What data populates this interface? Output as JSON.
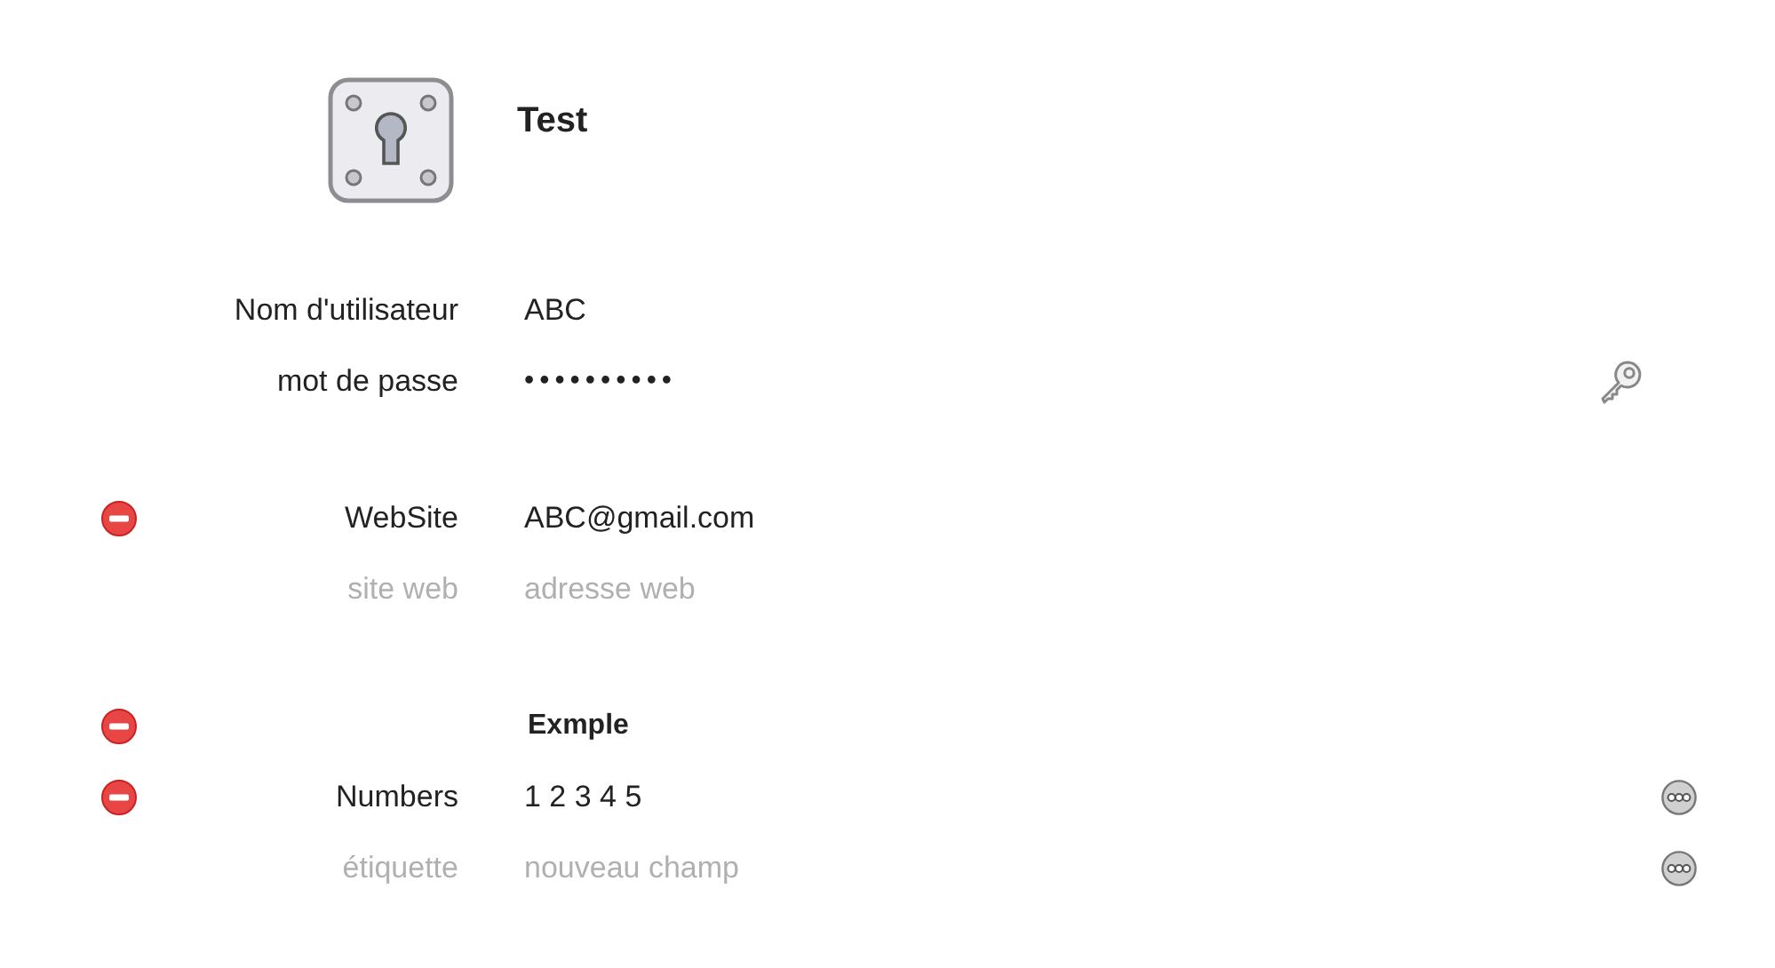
{
  "title": "Test",
  "groups": [
    {
      "rows": [
        {
          "kind": "field",
          "label": "Nom d'utilisateur",
          "value": "ABC",
          "removable": false,
          "key_button": false,
          "options_button": false
        },
        {
          "kind": "secret",
          "label": "mot de passe",
          "value": "••••••••••",
          "removable": false,
          "key_button": true,
          "options_button": false
        }
      ]
    },
    {
      "rows": [
        {
          "kind": "field",
          "label": "WebSite",
          "value": "ABC@gmail.com",
          "removable": true,
          "key_button": false,
          "options_button": false
        },
        {
          "kind": "new_field",
          "label_placeholder": "site web",
          "placeholder": "adresse web",
          "removable": false,
          "key_button": false,
          "options_button": false
        }
      ]
    },
    {
      "rows": [
        {
          "kind": "section",
          "title": "Exmple",
          "removable": true,
          "key_button": false,
          "options_button": false
        },
        {
          "kind": "field",
          "label": "Numbers",
          "value": "1 2 3 4 5",
          "removable": true,
          "key_button": false,
          "options_button": true
        },
        {
          "kind": "new_field",
          "label_placeholder": "étiquette",
          "placeholder": "nouveau champ",
          "removable": false,
          "key_button": false,
          "options_button": true
        }
      ]
    }
  ]
}
